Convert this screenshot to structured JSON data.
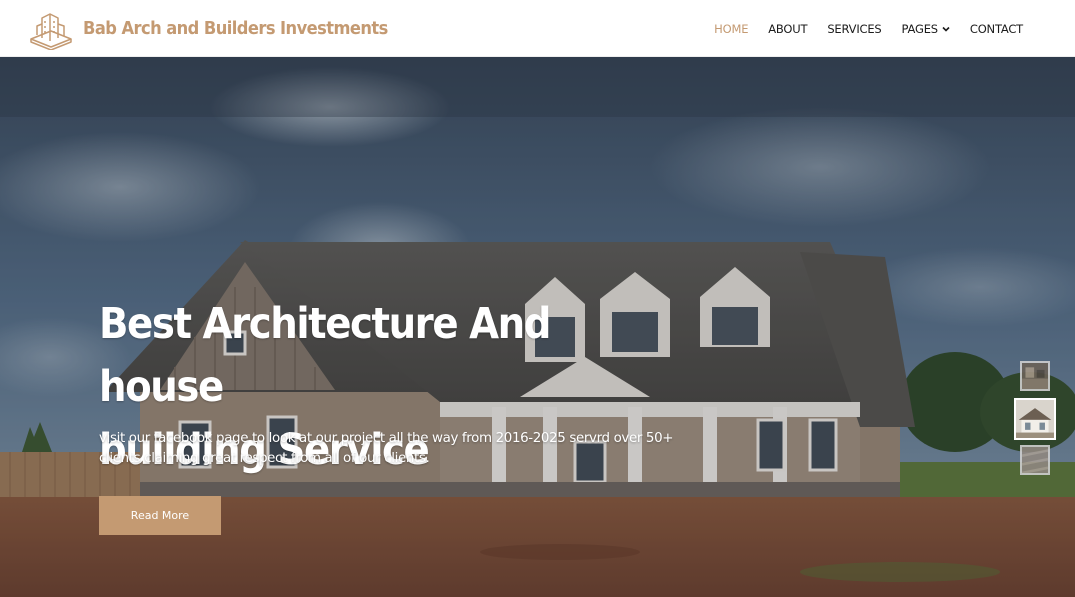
{
  "header": {
    "brand_name": "Bab Arch and Builders Investments",
    "logo_icon": "building-blueprint-logo",
    "nav": [
      {
        "label": "HOME",
        "active": true
      },
      {
        "label": "ABOUT",
        "active": false
      },
      {
        "label": "SERVICES",
        "active": false
      },
      {
        "label": "PAGES",
        "active": false,
        "dropdown": true
      },
      {
        "label": "CONTACT",
        "active": false
      }
    ]
  },
  "hero": {
    "title_line1": "Best Architecture And house",
    "title_line2": "building Service",
    "description": "visit our facebook page to look at our project all the way from 2016-2025 servrd over 50+ clients claiming great respect from all of our clients.",
    "button_label": "Read More",
    "slides": [
      "slide-thumbnail-1",
      "slide-thumbnail-2",
      "slide-thumbnail-3"
    ],
    "active_slide": 2
  },
  "colors": {
    "accent": "#c49a72",
    "nav_text": "#1c1c1c",
    "hero_text": "#ffffff"
  }
}
